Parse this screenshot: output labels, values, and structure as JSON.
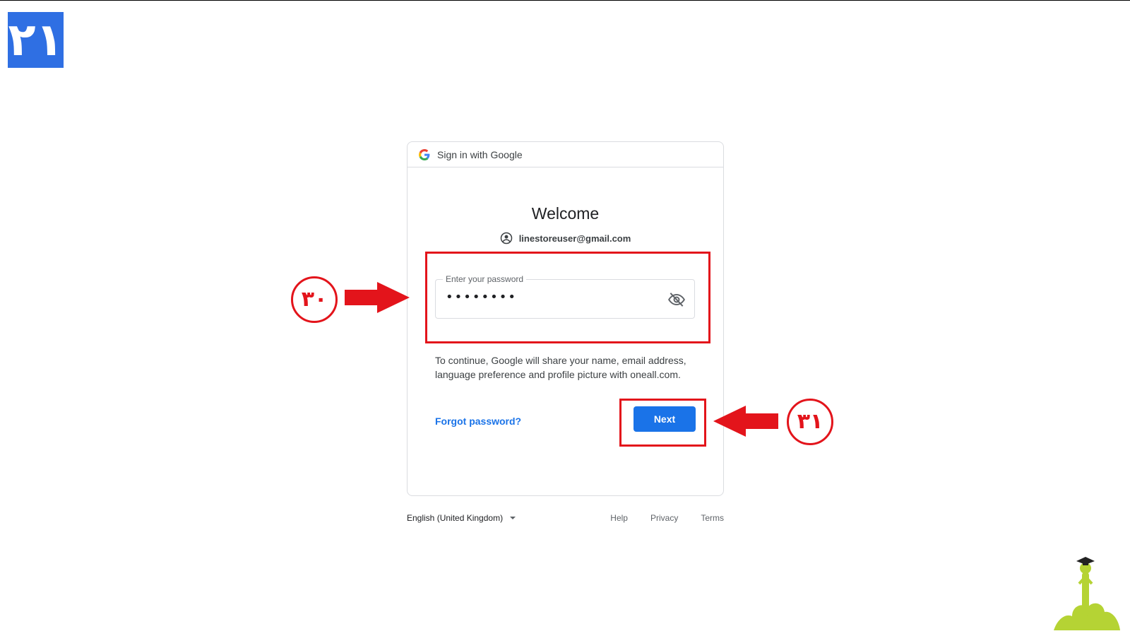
{
  "step_badge": "۲۱",
  "dialog": {
    "header_title": "Sign in with Google",
    "heading": "Welcome",
    "account_email": "linestoreuser@gmail.com",
    "password_label": "Enter your password",
    "password_value": "••••••••",
    "consent_text": "To continue, Google will share your name, email address, language preference and profile picture with oneall.com.",
    "forgot_label": "Forgot password?",
    "next_label": "Next"
  },
  "footer": {
    "language": "English (United Kingdom)",
    "links": [
      "Help",
      "Privacy",
      "Terms"
    ]
  },
  "annotations": {
    "marker_password": "۳۰",
    "marker_next": "۳۱"
  },
  "colors": {
    "brand_blue": "#1a73e8",
    "annotation_red": "#e3141b",
    "badge_blue": "#2f6fe3"
  },
  "icons": [
    "google-g-icon",
    "account-circle-icon",
    "eye-off-icon",
    "dropdown-caret-icon",
    "arrow-right-icon",
    "arrow-left-icon",
    "mascot-logo"
  ]
}
